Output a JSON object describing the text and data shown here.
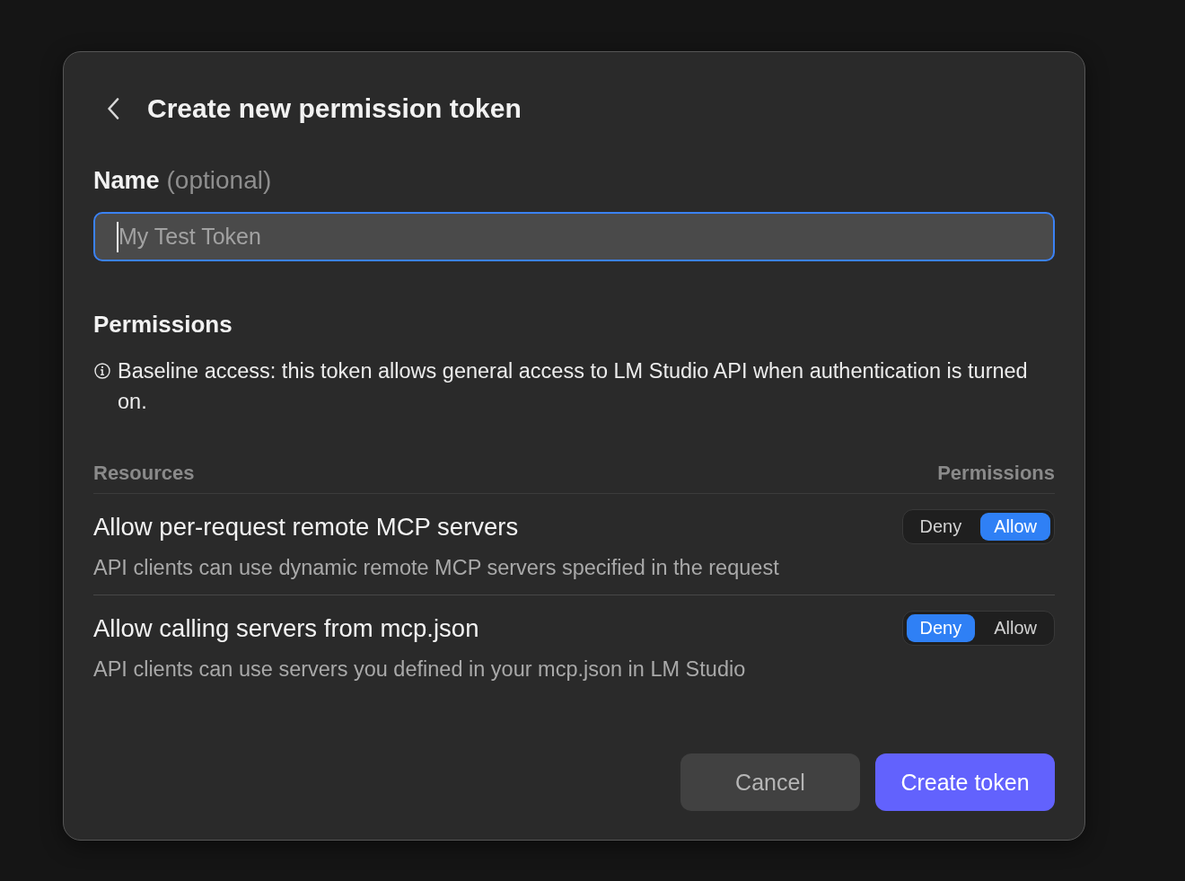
{
  "dialog": {
    "title": "Create new permission token",
    "name_field": {
      "label": "Name",
      "hint": "(optional)",
      "placeholder": "My Test Token",
      "focused": true
    },
    "permissions": {
      "heading": "Permissions",
      "note": "Baseline access: this token allows general access to LM Studio API when authentication is turned on.",
      "columns": [
        "Resources",
        "Permissions"
      ],
      "rows": [
        {
          "title": "Allow per-request remote MCP servers",
          "description": "API clients can use dynamic remote MCP servers specified in the request",
          "options": [
            {
              "label": "Deny",
              "selected": false
            },
            {
              "label": "Allow",
              "selected": true
            }
          ]
        },
        {
          "title": "Allow calling servers from mcp.json",
          "description": "API clients can use servers you defined in your mcp.json in LM Studio",
          "options": [
            {
              "label": "Deny",
              "selected": true
            },
            {
              "label": "Allow",
              "selected": false
            }
          ]
        }
      ]
    },
    "buttons": [
      {
        "label": "Cancel",
        "kind": "secondary"
      },
      {
        "label": "Create token",
        "kind": "primary"
      }
    ]
  }
}
